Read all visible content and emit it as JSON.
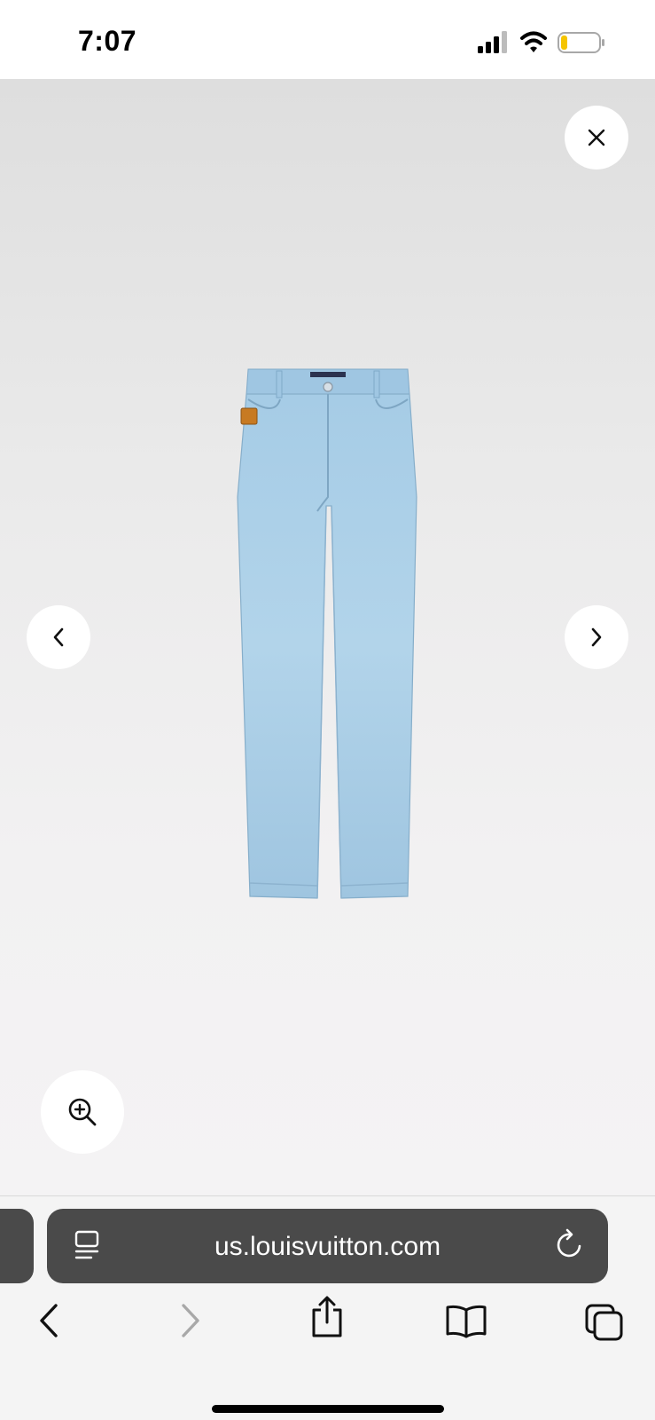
{
  "status_bar": {
    "time": "7:07",
    "battery_level": 0.15
  },
  "viewer": {
    "close_icon": "close-icon",
    "prev_icon": "chevron-left-icon",
    "next_icon": "chevron-right-icon",
    "zoom_icon": "zoom-in-icon",
    "product_image": "light blue denim jeans"
  },
  "browser": {
    "url": "us.louisvuitton.com",
    "toolbar": [
      "back-icon",
      "forward-icon",
      "share-icon",
      "bookmarks-icon",
      "tabs-icon"
    ]
  },
  "colors": {
    "address_bar": "#4a4a4a",
    "denim": "#a9cde6",
    "battery_fill": "#f5c400"
  }
}
